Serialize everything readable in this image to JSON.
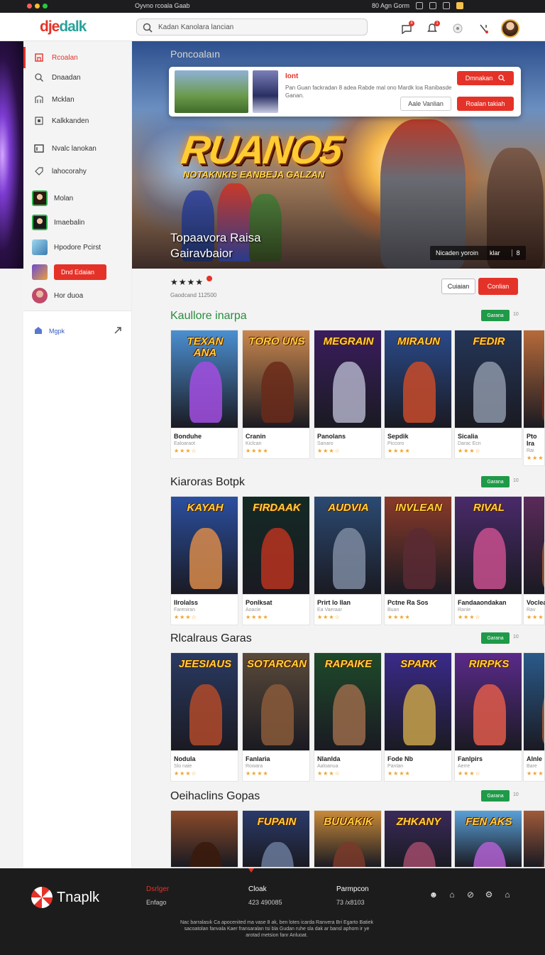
{
  "os": {
    "title": "Oyvno rcoala Gaab",
    "right_text": "80 Agn Gorm",
    "traffic": [
      "#ff5f57",
      "#febc2e",
      "#28c840"
    ]
  },
  "header": {
    "logo_part1": "dje",
    "logo_part2": "dalk",
    "search_placeholder": "Kadan Kanolara lancian",
    "badge1": "4",
    "badge2": "1"
  },
  "sidebar": {
    "items": [
      {
        "label": "Rcoalan",
        "icon": "home-icon"
      },
      {
        "label": "Dnaadan",
        "icon": "search-icon"
      },
      {
        "label": "Mcklan",
        "icon": "library-icon"
      },
      {
        "label": "Kalkkanden",
        "icon": "store-icon"
      },
      {
        "label": "Nvalc lanokan",
        "icon": "screen-icon"
      },
      {
        "label": "lahocorahy",
        "icon": "tag-icon"
      },
      {
        "label": "Molan",
        "icon": "user-thumb"
      },
      {
        "label": "Imaebalin",
        "icon": "user-thumb"
      },
      {
        "label": "Hpodore Pcirst",
        "icon": "user-thumb"
      },
      {
        "label": "Dnd Edaian",
        "icon": "user-thumb"
      },
      {
        "label": "Hor duoa",
        "icon": "user-thumb"
      }
    ],
    "bottom_label": "Mgpk"
  },
  "hero": {
    "kicker": "Poncoalaın",
    "title": "RUANO5",
    "subtitle": "NOTAKNKIS EANBEJA GALZAN",
    "caption_line1": "Topaavora Raisa",
    "caption_line2": "Gairavbaior",
    "pill_text": "Nicaden yoroin",
    "pill_sub": "klar",
    "pill_num": "8"
  },
  "popup": {
    "title": "Iont",
    "desc": "Pan Guan fackradan 8 adea Rabde mal ono Mardk loa Ranibasde Ganan.",
    "btn1": "Dmnakan",
    "btn2": "Aale Vanlian",
    "btn3": "Roalan takiah"
  },
  "rating": {
    "stars": "★★★★",
    "meta": "Gaodcand 112500"
  },
  "actions": {
    "outline": "Cuiaian",
    "red": "Conlian"
  },
  "sections": [
    {
      "title": "Kaullore inarpa",
      "btn": "Garana",
      "count": "10",
      "cards": [
        {
          "art_title": "TEXAN ANA",
          "name": "Bonduhe",
          "sub": "Ealoaraot",
          "stars": "★★★☆",
          "bg": "#4b8fd1",
          "fig": "#a24ee0"
        },
        {
          "art_title": "TORO UNS",
          "name": "Cranin",
          "sub": "Kiclcan",
          "stars": "★★★★",
          "bg": "#c9874e",
          "fig": "#6a2a1a"
        },
        {
          "art_title": "MEGRAIN",
          "name": "Panolans",
          "sub": "Sanaro",
          "stars": "★★★☆",
          "bg": "#3a1d5e",
          "fig": "#b0b0c8"
        },
        {
          "art_title": "MIRAUN",
          "name": "Sepdik",
          "sub": "Piccoro",
          "stars": "★★★★",
          "bg": "#2a4a8a",
          "fig": "#c84b2a"
        },
        {
          "art_title": "FEDIR",
          "name": "Sicalia",
          "sub": "Darac Ecn",
          "stars": "★★★☆",
          "bg": "#243658",
          "fig": "#8c96a8"
        },
        {
          "art_title": "PTO",
          "name": "Pto Ira",
          "sub": "Rai",
          "stars": "★★★",
          "bg": "#b76a3a",
          "fig": "#7a2a1a"
        }
      ]
    },
    {
      "title": "Kiaroras Botpk",
      "btn": "Garana",
      "count": "10",
      "cards": [
        {
          "art_title": "KAYAH",
          "name": "Ilrolalss",
          "sub": "Fareniran",
          "stars": "★★★☆",
          "bg": "#2b4fa0",
          "fig": "#d88a4a"
        },
        {
          "art_title": "FIRDAAK",
          "name": "Ponlksat",
          "sub": "Aoacie",
          "stars": "★★★★",
          "bg": "#142a24",
          "fig": "#b8321e"
        },
        {
          "art_title": "AUDVIA",
          "name": "Prirt lo llan",
          "sub": "Ea Vaeraar",
          "stars": "★★★☆",
          "bg": "#2b4a72",
          "fig": "#7c8aa0"
        },
        {
          "art_title": "INVLEAN",
          "name": "Pctne Ra Sos",
          "sub": "Buan",
          "stars": "★★★★",
          "bg": "#8a3a2a",
          "fig": "#5a2a34"
        },
        {
          "art_title": "RIVAL",
          "name": "Fandaaondakan",
          "sub": "Ranie",
          "stars": "★★★☆",
          "bg": "#4a2a6a",
          "fig": "#c84f8e"
        },
        {
          "art_title": "VOO",
          "name": "Voclea",
          "sub": "Rav",
          "stars": "★★★",
          "bg": "#5a2a5a",
          "fig": "#a05a3a"
        }
      ]
    },
    {
      "title": "Rlcalraus Garas",
      "btn": "Garana",
      "count": "10",
      "cards": [
        {
          "art_title": "JEESIAUS",
          "name": "Nodula",
          "sub": "Slo naie",
          "stars": "★★★☆",
          "bg": "#2a3a62",
          "fig": "#b24a2a"
        },
        {
          "art_title": "SOTARCAN",
          "name": "Fanlaria",
          "sub": "Rowara",
          "stars": "★★★★",
          "bg": "#5a4a3a",
          "fig": "#8a5a3a"
        },
        {
          "art_title": "RAPAIKE",
          "name": "Nlanlda",
          "sub": "Aaloanua",
          "stars": "★★★☆",
          "bg": "#1e4a2a",
          "fig": "#9a6a4a"
        },
        {
          "art_title": "SPARK",
          "name": "Fode Nb",
          "sub": "Pantan",
          "stars": "★★★★",
          "bg": "#3a2a8a",
          "fig": "#c8a24a"
        },
        {
          "art_title": "RIRPKS",
          "name": "Fanlpirs",
          "sub": "Aerre",
          "stars": "★★★☆",
          "bg": "#5a2a8a",
          "fig": "#e05a4a"
        },
        {
          "art_title": "ALN",
          "name": "Alnle",
          "sub": "Bare",
          "stars": "★★★",
          "bg": "#2a5a8a",
          "fig": "#aa5a3a"
        }
      ]
    },
    {
      "title": "Oeihaclins Gopas",
      "btn": "Garana",
      "count": "10",
      "cards": [
        {
          "art_title": "",
          "name": "",
          "sub": "",
          "stars": "",
          "bg": "#8a4a2a",
          "fig": "#3a1a0a"
        },
        {
          "art_title": "FUPAIN",
          "name": "",
          "sub": "",
          "stars": "",
          "bg": "#2a3a6a",
          "fig": "#6a7a9a"
        },
        {
          "art_title": "BUUAKIK",
          "name": "",
          "sub": "",
          "stars": "",
          "bg": "#c88a3a",
          "fig": "#7a3a2a"
        },
        {
          "art_title": "ZHKANY",
          "name": "",
          "sub": "",
          "stars": "",
          "bg": "#3a2a5a",
          "fig": "#a04a6a"
        },
        {
          "art_title": "FEN AKS",
          "name": "",
          "sub": "",
          "stars": "",
          "bg": "#5aa0d8",
          "fig": "#b060d0"
        },
        {
          "art_title": "",
          "name": "",
          "sub": "",
          "stars": "",
          "bg": "#a05a3a",
          "fig": "#5a2a1a"
        }
      ]
    }
  ],
  "footer": {
    "logo": "Tnaplk",
    "col1_head": "Dsrlger",
    "col1_val": "Enfago",
    "col2_head": "Cloak",
    "col2_val": "423 490085",
    "col3_head": "Parmpcon",
    "col3_val": "73 /x8103",
    "fine": "Nac barralasık Ca apocenited ma vase 8 ak, ben lotes icarda Ranvera Bri Egarto Batiek sacoatolan fanvala Kaer fransaralan tsi bla Gudan ruhe sla dak ar bansl aphom ir ye arotad metsion fanr Anluoat."
  }
}
